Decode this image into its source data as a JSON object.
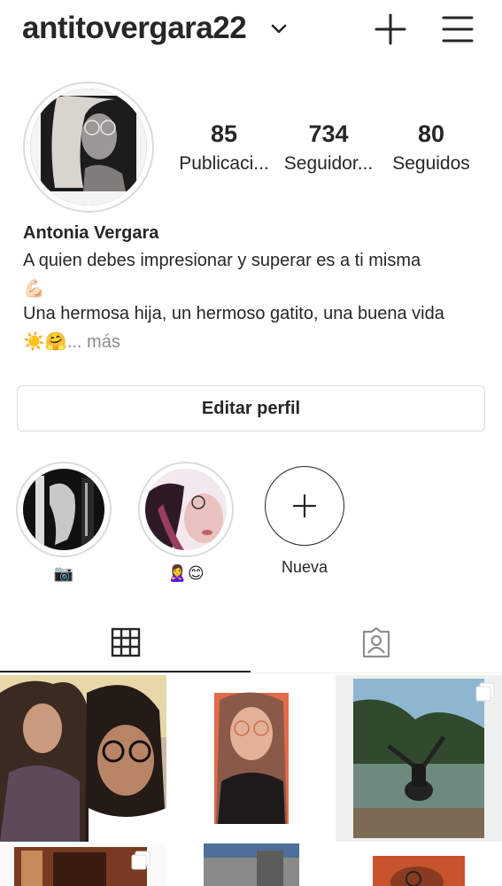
{
  "header": {
    "username": "antitovergara22",
    "icons": [
      "chevron-down-icon",
      "plus-icon",
      "hamburger-menu-icon"
    ]
  },
  "profile": {
    "stats": [
      {
        "value": "85",
        "label": "Publicaci..."
      },
      {
        "value": "734",
        "label": "Seguidor..."
      },
      {
        "value": "80",
        "label": "Seguidos"
      }
    ],
    "name": "Antonia Vergara",
    "bio_line1": "A quien debes impresionar y superar es a ti misma",
    "bio_line2_emoji": "💪🏻",
    "bio_line3": "Una hermosa hija, un hermoso gatito, una buena vida",
    "bio_line4_emoji": "☀️🤗",
    "more_label": "... más"
  },
  "edit_button": "Editar perfil",
  "highlights": [
    {
      "label": "📷"
    },
    {
      "label": "🙎‍♀️😊"
    },
    {
      "label": "Nueva"
    }
  ],
  "tabs": [
    {
      "icon": "grid-icon",
      "active": true
    },
    {
      "icon": "tagged-person-icon",
      "active": false
    }
  ],
  "colors": {
    "text": "#262626",
    "muted": "#8e8e8e",
    "border": "#dbdbdb"
  }
}
